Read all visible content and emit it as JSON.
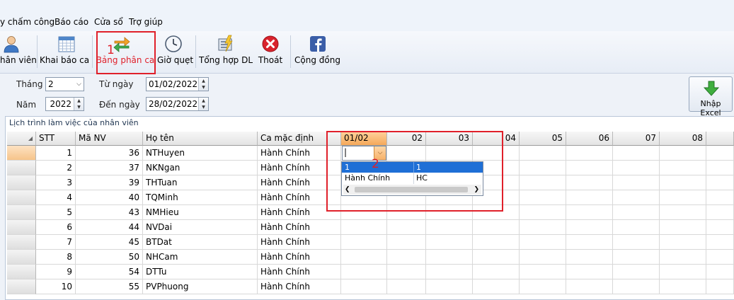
{
  "menu": {
    "items": [
      "y chấm công",
      "Báo cáo",
      "Cửa sổ",
      "Trợ giúp"
    ]
  },
  "toolbar": {
    "buttons": [
      {
        "label": "hân viên",
        "icon": "user-icon"
      },
      {
        "label": "Khai báo ca",
        "icon": "calendar-icon"
      },
      {
        "label": "Bảng phân ca",
        "icon": "swap-arrows-icon"
      },
      {
        "label": "Giờ quẹt",
        "icon": "clock-icon"
      },
      {
        "label": "Tổng hợp DL",
        "icon": "summary-document-icon"
      },
      {
        "label": "Thoát",
        "icon": "close-icon"
      },
      {
        "label": "Cộng đồng",
        "icon": "facebook-icon"
      }
    ]
  },
  "annotations": {
    "one": "1",
    "two": "2"
  },
  "filter": {
    "month_label": "Tháng",
    "month_value": "2",
    "year_label": "Năm",
    "year_value": "2022",
    "from_label": "Từ ngày",
    "from_value": "01/02/2022",
    "to_label": "Đến ngày",
    "to_value": "28/02/2022",
    "import_label": "Nhập Excel"
  },
  "group_title": "Lịch trình làm việc của nhân viên",
  "grid": {
    "headers": {
      "stt": "STT",
      "ma_nv": "Mã NV",
      "ho_ten": "Họ tên",
      "ca": "Ca mặc định"
    },
    "days": [
      "01/02",
      "02",
      "03",
      "04",
      "05",
      "06",
      "07",
      "08"
    ],
    "rows": [
      {
        "stt": "1",
        "ma": "36",
        "name": "NTHuyen",
        "ca": "Hành Chính"
      },
      {
        "stt": "2",
        "ma": "37",
        "name": "NKNgan",
        "ca": "Hành Chính"
      },
      {
        "stt": "3",
        "ma": "39",
        "name": "THTuan",
        "ca": "Hành Chính"
      },
      {
        "stt": "4",
        "ma": "40",
        "name": "TQMinh",
        "ca": "Hành Chính"
      },
      {
        "stt": "5",
        "ma": "43",
        "name": "NMHieu",
        "ca": "Hành Chính"
      },
      {
        "stt": "6",
        "ma": "44",
        "name": "NVDai",
        "ca": "Hành Chính"
      },
      {
        "stt": "7",
        "ma": "45",
        "name": "BTDat",
        "ca": "Hành Chính"
      },
      {
        "stt": "8",
        "ma": "50",
        "name": "NHCam",
        "ca": "Hành Chính"
      },
      {
        "stt": "9",
        "ma": "54",
        "name": "DTTu",
        "ca": "Hành Chính"
      },
      {
        "stt": "10",
        "ma": "55",
        "name": "PVPhuong",
        "ca": "Hành Chính"
      }
    ],
    "editor_value": "|"
  },
  "dropdown": {
    "options": [
      {
        "name": "1",
        "code": "1"
      },
      {
        "name": "Hành Chính",
        "code": "HC"
      }
    ]
  },
  "colors": {
    "highlight_red": "#e0202a",
    "selected_blue": "#1f6fd6",
    "active_header_orange": "#f5b46e",
    "selected_row_header": "#f9d3a8"
  }
}
